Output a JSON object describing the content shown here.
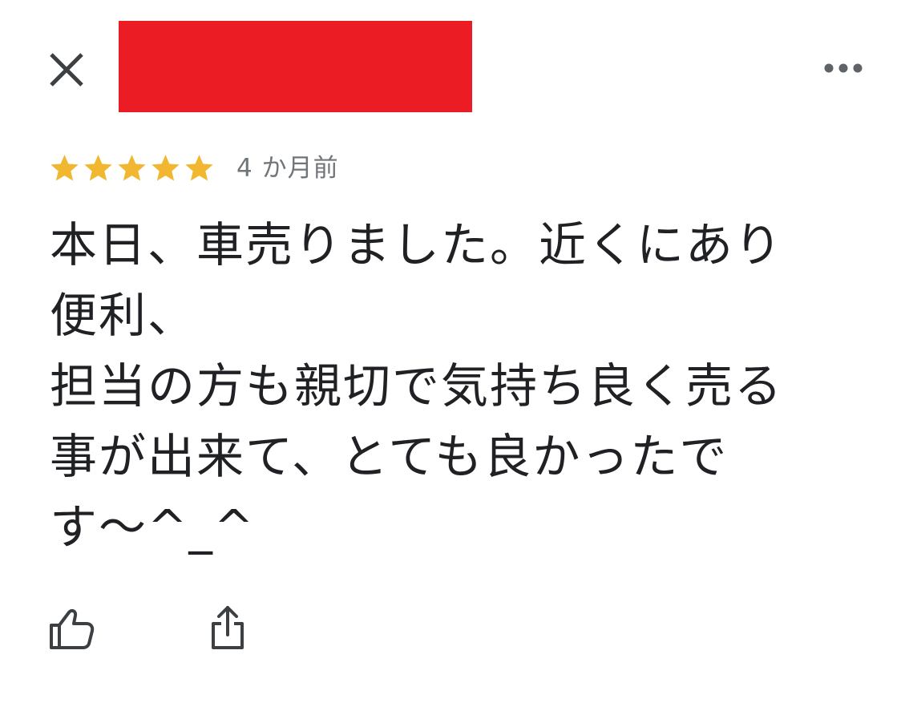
{
  "header": {
    "close_icon": "close-icon",
    "more_icon": "more-horizontal-icon",
    "redaction_color": "#ec1c24"
  },
  "review": {
    "rating": 5,
    "rating_max": 5,
    "star_color": "#f2b731",
    "date": "4 か月前",
    "date_color": "#70757a",
    "text": "本日、車売りました。近くにあり便利、\n担当の方も親切で気持ち良く売る事が出来て、とても良かったです〜^_^"
  },
  "actions": {
    "like_icon": "thumbs-up-icon",
    "share_icon": "share-icon",
    "icon_color": "#3c4043"
  }
}
